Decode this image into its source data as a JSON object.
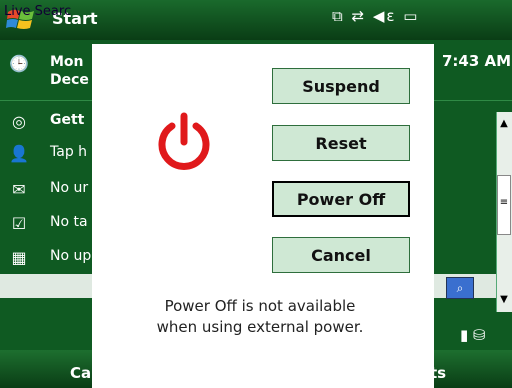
{
  "taskbar": {
    "start_label": "Start",
    "tray_icons": [
      "connectivity-icon",
      "sync-icon",
      "volume-muted-icon",
      "battery-icon"
    ]
  },
  "today": {
    "time": "7:43 AM",
    "date_line1": "Mon",
    "date_line2": "Dece",
    "items": [
      {
        "icon": "getting-started-icon",
        "text": "Gett"
      },
      {
        "icon": "owner-info-icon",
        "text": "Tap h"
      },
      {
        "icon": "messages-icon",
        "text": "No ur"
      },
      {
        "icon": "tasks-icon",
        "text": "No ta"
      },
      {
        "icon": "calendar-icon",
        "text": "No up"
      }
    ],
    "search_label": "Live Searc"
  },
  "softkeys": {
    "left": "Ca",
    "right": "ts"
  },
  "dialog": {
    "buttons": {
      "suspend": "Suspend",
      "reset": "Reset",
      "power_off": "Power Off",
      "cancel": "Cancel"
    },
    "message_line1": "Power Off is not available",
    "message_line2": "when using external power.",
    "accent_color": "#e0191b"
  }
}
